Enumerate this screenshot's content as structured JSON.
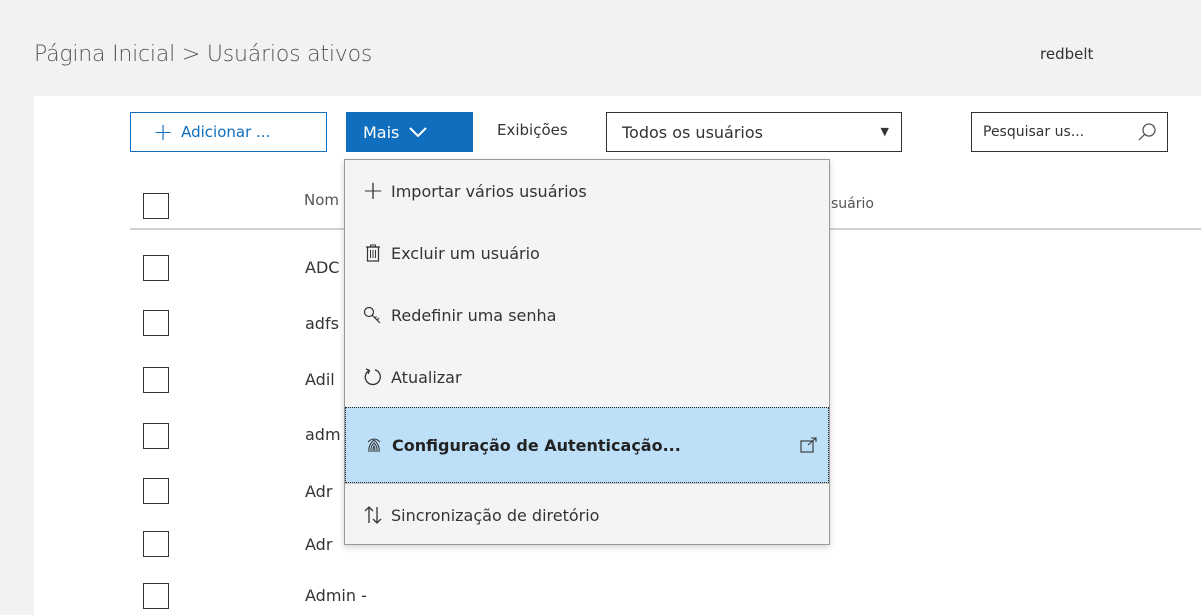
{
  "breadcrumb": {
    "home": "Página Inicial",
    "separator": ">",
    "current": "Usuários ativos"
  },
  "tenant": "redbelt",
  "toolbar": {
    "add_label": "Adicionar ...",
    "more_label": "Mais",
    "views_label": "Exibições",
    "views_selected": "Todos os usuários",
    "search_placeholder": "Pesquisar us..."
  },
  "table": {
    "col_name_partial": "Nom",
    "col_username_partial": "suário",
    "rows": [
      "ADC",
      "adfs",
      "Adil",
      "adm",
      "Adr",
      "Adr",
      "Admin - "
    ]
  },
  "more_menu": {
    "items": [
      {
        "label": "Importar vários usuários",
        "icon": "plus-icon"
      },
      {
        "label": "Excluir um usuário",
        "icon": "trash-icon"
      },
      {
        "label": "Redefinir uma senha",
        "icon": "key-icon"
      },
      {
        "label": "Atualizar",
        "icon": "refresh-icon"
      },
      {
        "label": "Configuração de Autenticação...",
        "icon": "fingerprint-icon",
        "external": "external-link-icon"
      },
      {
        "label": "Sincronização de diretório",
        "icon": "sync-arrows-icon"
      }
    ]
  },
  "colors": {
    "accent": "#106ebe",
    "highlight": "#bde0f8",
    "background": "#f2f2f2"
  }
}
